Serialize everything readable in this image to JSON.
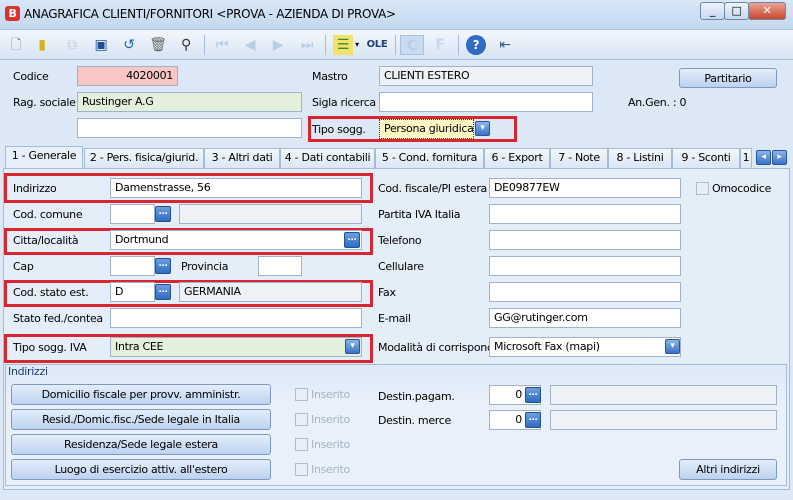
{
  "window": {
    "title": "ANAGRAFICA CLIENTI/FORNITORI <PROVA - AZIENDA DI PROVA>",
    "app_icon": "B",
    "minimize": "_",
    "maximize": "□",
    "close": "✕"
  },
  "toolbar": {
    "ole_label": "OLE",
    "c_label": "C",
    "f_label": "F"
  },
  "header": {
    "codice_label": "Codice",
    "codice": "4020001",
    "mastro_label": "Mastro",
    "mastro": "CLIENTI ESTERO",
    "partitario": "Partitario",
    "rag_sociale_label": "Rag. sociale",
    "rag_sociale": "Rustinger A.G",
    "sigla_label": "Sigla ricerca",
    "sigla": "",
    "angen": "An.Gen. : 0",
    "extra": "",
    "tipo_sogg_label": "Tipo sogg.",
    "tipo_sogg": "Persona giuridica"
  },
  "tabs": [
    "1 - Generale",
    "2 - Pers. fisica/giurid.",
    "3 - Altri dati",
    "4 - Dati contabili",
    "5 - Cond. fornitura",
    "6 - Export",
    "7 - Note",
    "8 - Listini",
    "9 - Sconti",
    "1"
  ],
  "general": {
    "indirizzo_label": "Indirizzo",
    "indirizzo": "Damenstrasse, 56",
    "cod_comune_label": "Cod. comune",
    "cod_comune": "",
    "comune_desc": "",
    "citta_label": "Citta/località",
    "citta": "Dortmund",
    "cap_label": "Cap",
    "cap": "",
    "provincia_label": "Provincia",
    "provincia": "",
    "stato_label": "Cod. stato est.",
    "stato": "D",
    "stato_desc": "GERMANIA",
    "statofed_label": "Stato fed./contea",
    "statofed": "",
    "tipo_iva_label": "Tipo sogg. IVA",
    "tipo_iva": "Intra CEE",
    "cf_label": "Cod. fiscale/PI estera",
    "cf": "DE09877EW",
    "omocodice": "Omocodice",
    "piva_label": "Partita IVA Italia",
    "piva": "",
    "telefono_label": "Telefono",
    "telefono": "",
    "cellulare_label": "Cellulare",
    "cellulare": "",
    "fax_label": "Fax",
    "fax": "",
    "email_label": "E-mail",
    "email": "GG@rutinger.com",
    "modalita_label": "Modalità di corrispond.",
    "modalita": "Microsoft Fax (mapi)"
  },
  "indirizzi": {
    "title": "Indirizzi",
    "buttons": [
      "Domicilio fiscale per provv. amministr.",
      "Resid./Domic.fisc./Sede legale in Italia",
      "Residenza/Sede legale estera",
      "Luogo di esercizio attiv. all'estero"
    ],
    "inserito": "Inserito",
    "destin_pagam_label": "Destin.pagam.",
    "destin_pagam": "0",
    "destin_merce_label": "Destin. merce",
    "destin_merce": "0",
    "altri": "Altri indirizzi"
  }
}
